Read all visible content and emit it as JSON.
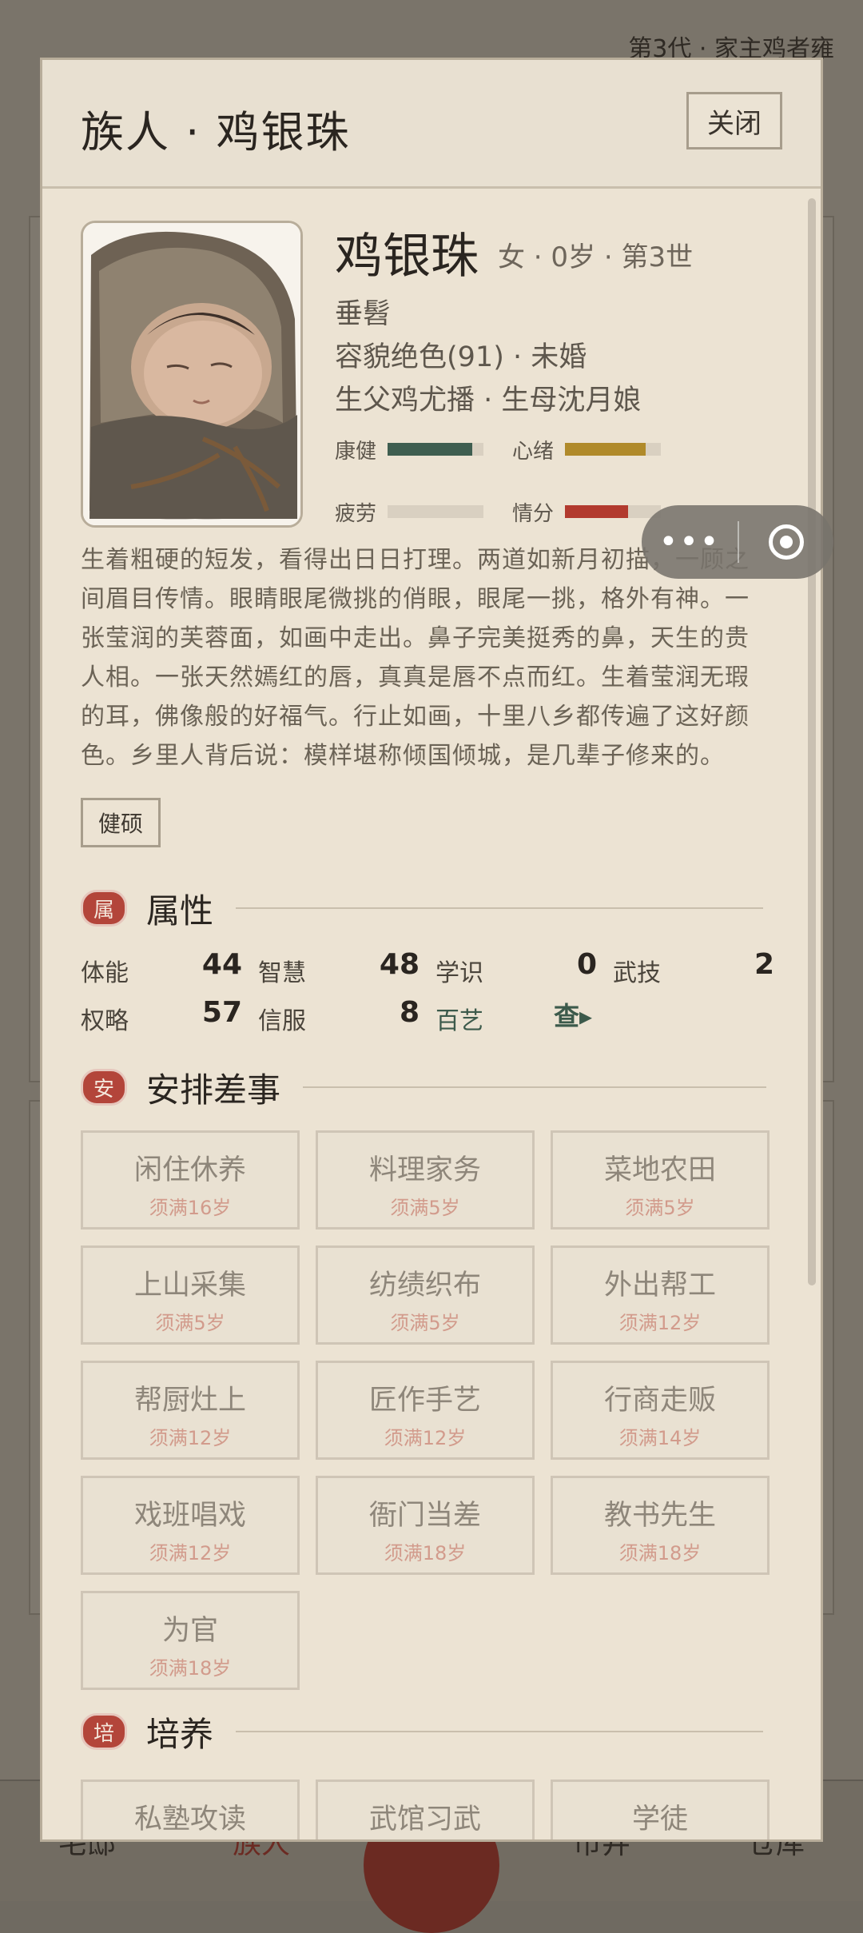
{
  "background": {
    "header_right": "第3代 · 家主鸡者雍",
    "nav": [
      "宅邸",
      "族人",
      "市井",
      "仓库"
    ]
  },
  "modal": {
    "title": "族人 · 鸡银珠",
    "close_label": "关闭"
  },
  "profile": {
    "name": "鸡银珠",
    "meta": "女 · 0岁 · 第3世",
    "hair": "垂髫",
    "looks": "容貌绝色(91) · 未婚",
    "parents": "生父鸡尤播 · 生母沈月娘",
    "bars": [
      {
        "label": "康健",
        "value": 0.88,
        "color": "#3f5e50"
      },
      {
        "label": "心绪",
        "value": 0.84,
        "color": "#b08a2a"
      },
      {
        "label": "疲劳",
        "value": 0.0,
        "color": "#d9d0c1"
      },
      {
        "label": "情分",
        "value": 0.66,
        "color": "#b23a2e"
      }
    ],
    "description": "生着粗硬的短发，看得出日日打理。两道如新月初描，一顾之间眉目传情。眼睛眼尾微挑的俏眼，眼尾一挑，格外有神。一张莹润的芙蓉面，如画中走出。鼻子完美挺秀的鼻，天生的贵人相。一张天然嫣红的唇，真真是唇不点而红。生着莹润无瑕的耳，佛像般的好福气。行止如画，十里八乡都传遍了这好颜色。乡里人背后说：模样堪称倾国倾城，是几辈子修来的。",
    "trait": "健硕"
  },
  "attributes": {
    "seal": "属",
    "title": "属性",
    "items": [
      {
        "label": "体能",
        "value": "44"
      },
      {
        "label": "智慧",
        "value": "48"
      },
      {
        "label": "学识",
        "value": "0"
      },
      {
        "label": "武技",
        "value": "2"
      },
      {
        "label": "权略",
        "value": "57"
      },
      {
        "label": "信服",
        "value": "8"
      },
      {
        "label": "百艺",
        "value": "查▸"
      }
    ]
  },
  "tasks": {
    "seal": "安",
    "title": "安排差事",
    "items": [
      {
        "name": "闲住休养",
        "req": "须满16岁"
      },
      {
        "name": "料理家务",
        "req": "须满5岁"
      },
      {
        "name": "菜地农田",
        "req": "须满5岁"
      },
      {
        "name": "上山采集",
        "req": "须满5岁"
      },
      {
        "name": "纺绩织布",
        "req": "须满5岁"
      },
      {
        "name": "外出帮工",
        "req": "须满12岁"
      },
      {
        "name": "帮厨灶上",
        "req": "须满12岁"
      },
      {
        "name": "匠作手艺",
        "req": "须满12岁"
      },
      {
        "name": "行商走贩",
        "req": "须满14岁"
      },
      {
        "name": "戏班唱戏",
        "req": "须满12岁"
      },
      {
        "name": "衙门当差",
        "req": "须满18岁"
      },
      {
        "name": "教书先生",
        "req": "须满18岁"
      },
      {
        "name": "为官",
        "req": "须满18岁"
      }
    ]
  },
  "training": {
    "seal": "培",
    "title": "培养",
    "items": [
      "私塾攻读",
      "武馆习武",
      "学徒"
    ]
  }
}
